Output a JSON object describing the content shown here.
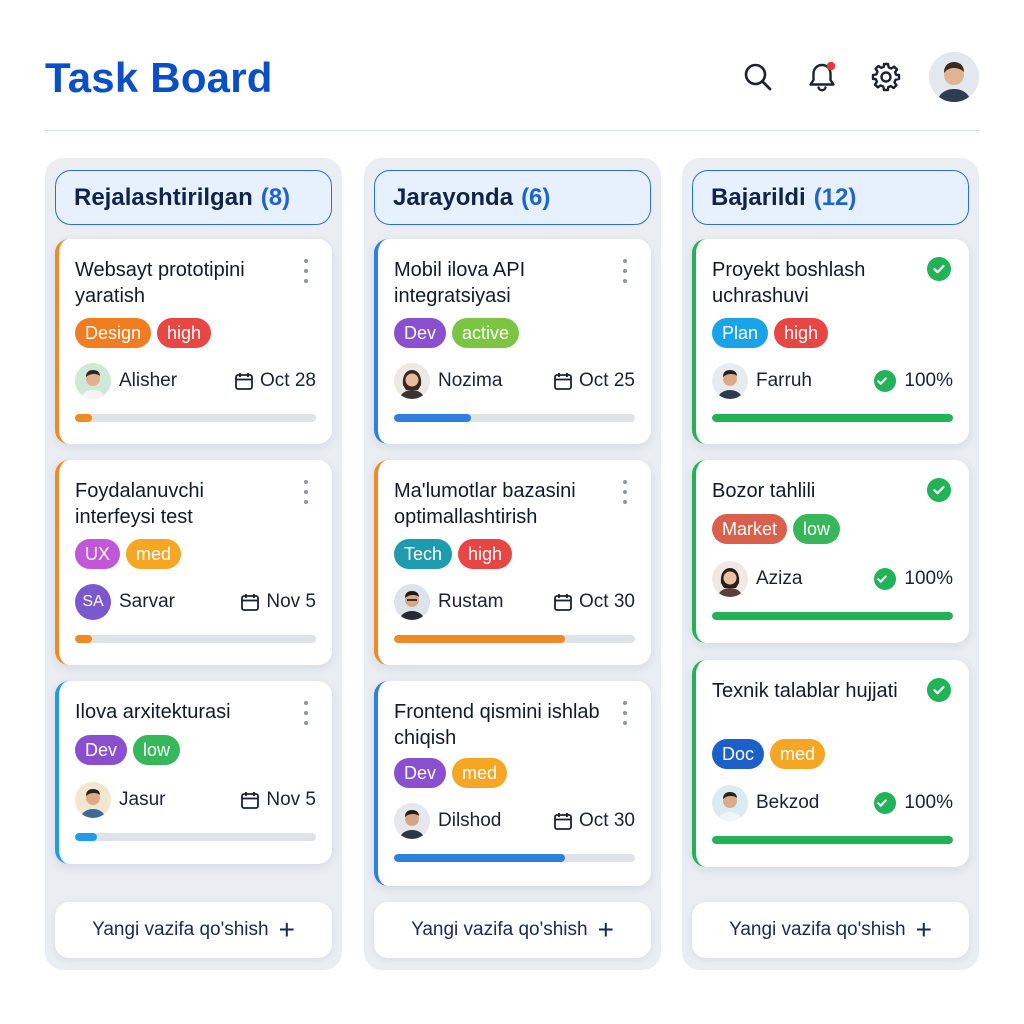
{
  "header": {
    "title": "Task Board",
    "icons": [
      "search-icon",
      "bell-icon",
      "gear-icon",
      "user-avatar"
    ],
    "notification_dot_color": "#e53935"
  },
  "columns": [
    {
      "name": "Rejalashtirilgan",
      "count": "(8)",
      "add_label": "Yangi vazifa qo'shish",
      "cards": [
        {
          "title": "Websayt prototipini yaratish",
          "accent": "#f08a24",
          "tags": [
            {
              "label": "Design",
              "color": "#f07d22"
            },
            {
              "label": "high",
              "color": "#e84545"
            }
          ],
          "assignee": "Alisher",
          "date": "Oct 28",
          "progress": 0.07,
          "progress_color": "#f08a24"
        },
        {
          "title": "Foydalanuvchi interfeysi test",
          "accent": "#f08a24",
          "tags": [
            {
              "label": "UX",
              "color": "#c156d6"
            },
            {
              "label": "med",
              "color": "#f5a623"
            }
          ],
          "assignee": "Sarvar",
          "initials": "SA",
          "date": "Nov 5",
          "progress": 0.07,
          "progress_color": "#f08a24"
        },
        {
          "title": "Ilova arxitekturasi",
          "accent": "#1f9bea",
          "tags": [
            {
              "label": "Dev",
              "color": "#8a4fcf"
            },
            {
              "label": "low",
              "color": "#38b65a"
            }
          ],
          "assignee": "Jasur",
          "date": "Nov 5",
          "progress": 0.09,
          "progress_color": "#1f9bea"
        }
      ]
    },
    {
      "name": "Jarayonda",
      "count": "(6)",
      "add_label": "Yangi vazifa qo'shish",
      "cards": [
        {
          "title": "Mobil ilova API integratsiyasi",
          "accent": "#2d7fe0",
          "tags": [
            {
              "label": "Dev",
              "color": "#8a4fcf"
            },
            {
              "label": "active",
              "color": "#7cc444"
            }
          ],
          "assignee": "Nozima",
          "date": "Oct 25",
          "progress": 0.32,
          "progress_color": "#2d7fe0"
        },
        {
          "title": "Ma'lumotlar bazasini optimallashtirish",
          "accent": "#f08a24",
          "tags": [
            {
              "label": "Tech",
              "color": "#1f9bb0"
            },
            {
              "label": "high",
              "color": "#e84545"
            }
          ],
          "assignee": "Rustam",
          "date": "Oct 30",
          "progress": 0.71,
          "progress_color": "#f08a24"
        },
        {
          "title": "Frontend qismini ishlab chiqish",
          "accent": "#2d7fe0",
          "tags": [
            {
              "label": "Dev",
              "color": "#8a4fcf"
            },
            {
              "label": "med",
              "color": "#f5a623"
            }
          ],
          "assignee": "Dilshod",
          "date": "Oct 30",
          "progress": 0.71,
          "progress_color": "#2d7fe0"
        }
      ]
    },
    {
      "name": "Bajarildi",
      "count": "(12)",
      "add_label": "Yangi vazifa qo'shish",
      "cards": [
        {
          "title": "Proyekt boshlash uchrashuvi",
          "accent": "#22b257",
          "tags": [
            {
              "label": "Plan",
              "color": "#1aa3e8"
            },
            {
              "label": "high",
              "color": "#e84545"
            }
          ],
          "assignee": "Farruh",
          "percent": "100%",
          "progress": 1.0,
          "progress_color": "#22b257"
        },
        {
          "title": "Bozor tahlili",
          "accent": "#22b257",
          "tags": [
            {
              "label": "Market",
              "color": "#d9604c"
            },
            {
              "label": "low",
              "color": "#38b65a"
            }
          ],
          "assignee": "Aziza",
          "percent": "100%",
          "progress": 1.0,
          "progress_color": "#22b257"
        },
        {
          "title": "Texnik talablar hujjati",
          "accent": "#22b257",
          "tags": [
            {
              "label": "Doc",
              "color": "#1b5fc7"
            },
            {
              "label": "med",
              "color": "#f5a623"
            }
          ],
          "assignee": "Bekzod",
          "percent": "100%",
          "progress": 1.0,
          "progress_color": "#22b257"
        }
      ]
    }
  ]
}
